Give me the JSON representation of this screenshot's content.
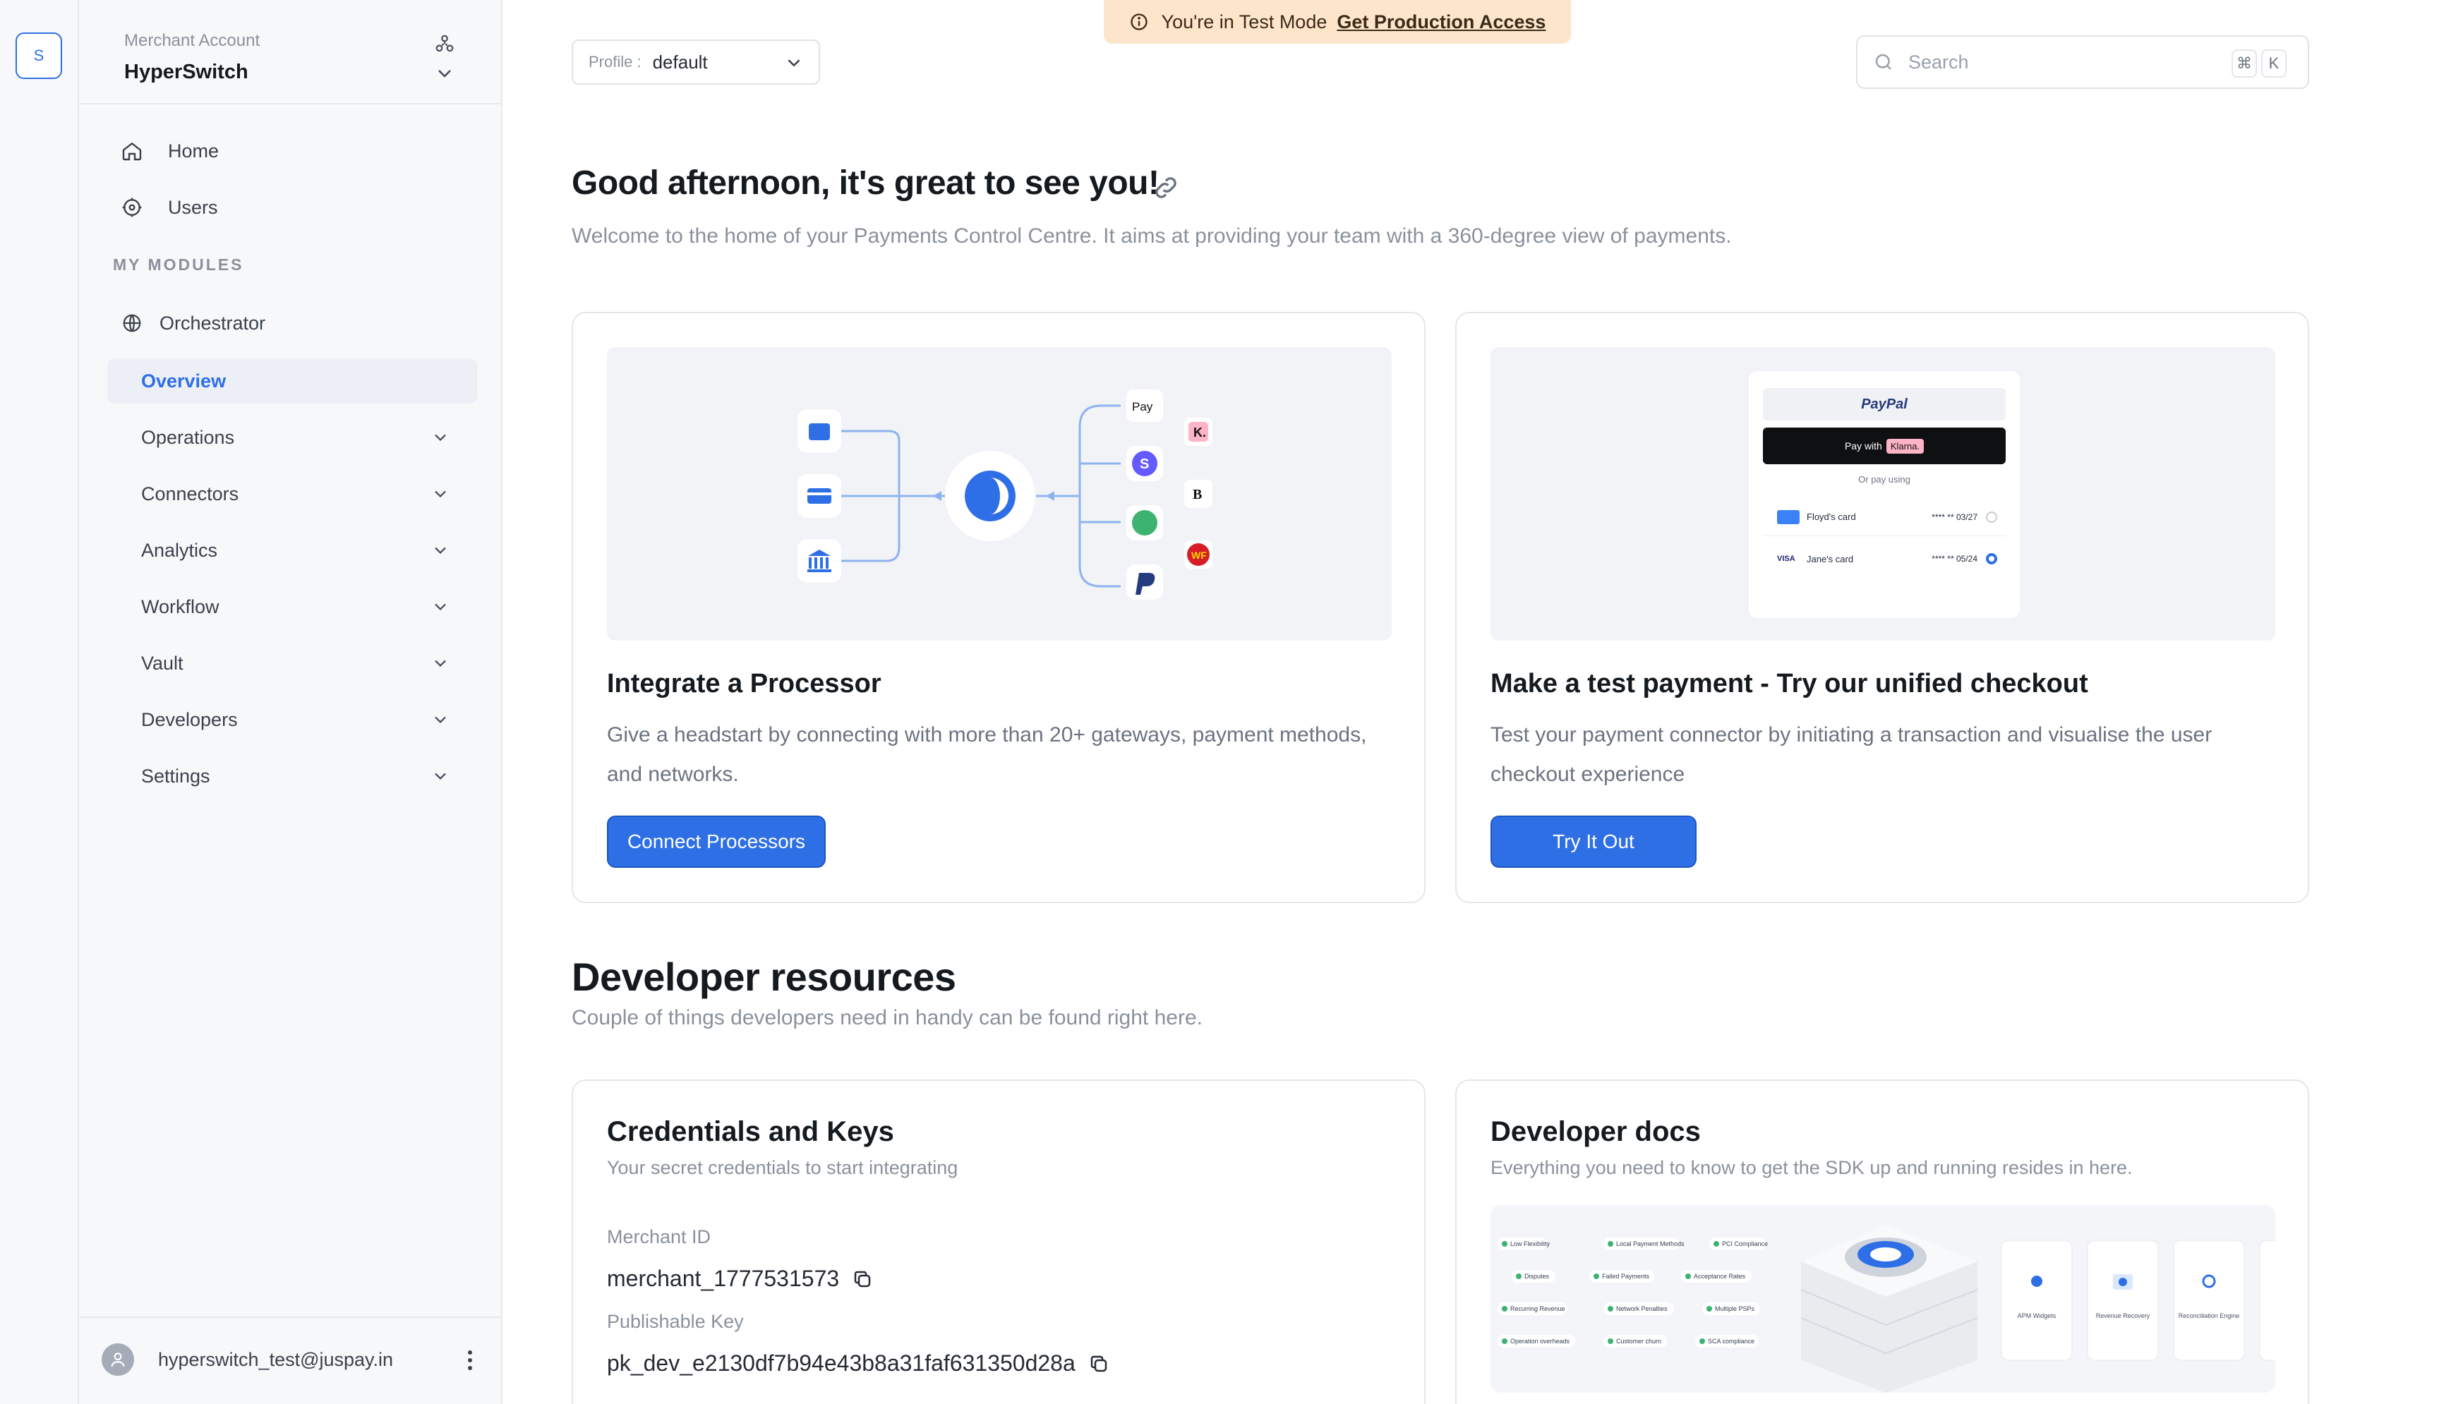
{
  "rail": {
    "badge": "S"
  },
  "account": {
    "label": "Merchant Account",
    "name": "HyperSwitch"
  },
  "nav": {
    "home": "Home",
    "users": "Users",
    "section": "MY MODULES",
    "orchestrator": "Orchestrator",
    "items": [
      {
        "label": "Overview",
        "active": true
      },
      {
        "label": "Operations"
      },
      {
        "label": "Connectors"
      },
      {
        "label": "Analytics"
      },
      {
        "label": "Workflow"
      },
      {
        "label": "Vault"
      },
      {
        "label": "Developers"
      },
      {
        "label": "Settings"
      }
    ]
  },
  "user": {
    "email": "hyperswitch_test@juspay.in"
  },
  "topbar": {
    "profile_label": "Profile :",
    "profile_value": "default",
    "banner_text": "You're in Test Mode",
    "banner_link": "Get Production Access",
    "search_placeholder": "Search",
    "shortcut_cmd": "⌘",
    "shortcut_key": "K"
  },
  "greeting": {
    "title": "Good afternoon, it's great to see you!",
    "subtitle": "Welcome to the home of your Payments Control Centre. It aims at providing your team with a 360-degree view of payments."
  },
  "cards": {
    "integrate": {
      "title": "Integrate a Processor",
      "desc": "Give a headstart by connecting with more than 20+ gateways, payment methods, and networks.",
      "button": "Connect Processors"
    },
    "test_payment": {
      "title": "Make a test payment - Try our unified checkout",
      "desc": "Test your payment connector by initiating a transaction and visualise the user checkout experience",
      "button": "Try It Out",
      "mock": {
        "paypal": "PayPal",
        "pay_with": "Pay with",
        "klarna": "Klarna.",
        "or": "Or pay using",
        "card1_name": "Floyd's card",
        "card1_num": "**** ** 03/27",
        "card2_name": "Jane's card",
        "card2_num": "**** ** 05/24",
        "visa": "VISA"
      }
    }
  },
  "dev": {
    "title": "Developer resources",
    "subtitle": "Couple of things developers need in handy can be found right here.",
    "credentials": {
      "title": "Credentials and Keys",
      "subtitle": "Your secret credentials to start integrating",
      "merchant_id_label": "Merchant ID",
      "merchant_id": "merchant_1777531573",
      "pub_key_label": "Publishable Key",
      "pub_key": "pk_dev_e2130df7b94e43b8a31faf631350d28a"
    },
    "docs": {
      "title": "Developer docs",
      "subtitle": "Everything you need to know to get the SDK up and running resides in here.",
      "chips": [
        "Low Flexibility",
        "Local Payment Methods",
        "PCI Compliance",
        "Disputes",
        "Failed Payments",
        "Acceptance Rates",
        "Recurring Revenue",
        "Network Penalties",
        "Multiple PSPs",
        "Operation overheads",
        "Customer churn",
        "SCA compliance"
      ],
      "modules": [
        "APM Widgets",
        "Revenue Recovery",
        "Reconciliation Engine"
      ]
    }
  },
  "colors": {
    "primary": "#2e6fe6",
    "banner": "#fde5cc",
    "sidebar": "#f7f8fa"
  }
}
